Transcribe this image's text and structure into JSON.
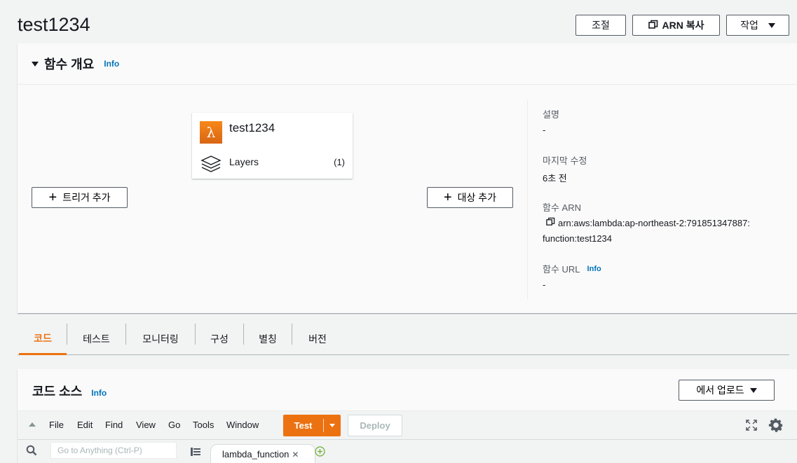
{
  "page": {
    "title": "test1234",
    "actions": {
      "throttle": "조절",
      "copy_arn": "ARN 복사",
      "actions_menu": "작업"
    }
  },
  "overview": {
    "heading": "함수 개요",
    "info": "Info",
    "function_card": {
      "name": "test1234",
      "layers_label": "Layers",
      "layers_count": "(1)"
    },
    "add_trigger": "트리거 추가",
    "add_destination": "대상 추가",
    "details": {
      "description_label": "설명",
      "description_value": "-",
      "last_modified_label": "마지막 수정",
      "last_modified_value": "6초 전",
      "arn_label": "함수 ARN",
      "arn_line1": "arn:aws:lambda:ap-northeast-2:791851347887:",
      "arn_line2": "function:test1234",
      "url_label": "함수 URL",
      "url_info": "Info",
      "url_value": "-"
    }
  },
  "tabs": [
    {
      "label": "코드",
      "active": true
    },
    {
      "label": "테스트",
      "active": false
    },
    {
      "label": "모니터링",
      "active": false
    },
    {
      "label": "구성",
      "active": false
    },
    {
      "label": "별칭",
      "active": false
    },
    {
      "label": "버전",
      "active": false
    }
  ],
  "code_source": {
    "heading": "코드 소스",
    "info": "Info",
    "upload": "에서 업로드",
    "menu": [
      "File",
      "Edit",
      "Find",
      "View",
      "Go",
      "Tools",
      "Window"
    ],
    "test_button": "Test",
    "deploy_button": "Deploy",
    "goto_placeholder": "Go to Anything (Ctrl-P)",
    "open_file": "lambda_function"
  },
  "colors": {
    "accent": "#ec7211",
    "link": "#0073bb",
    "text": "#16191f"
  }
}
